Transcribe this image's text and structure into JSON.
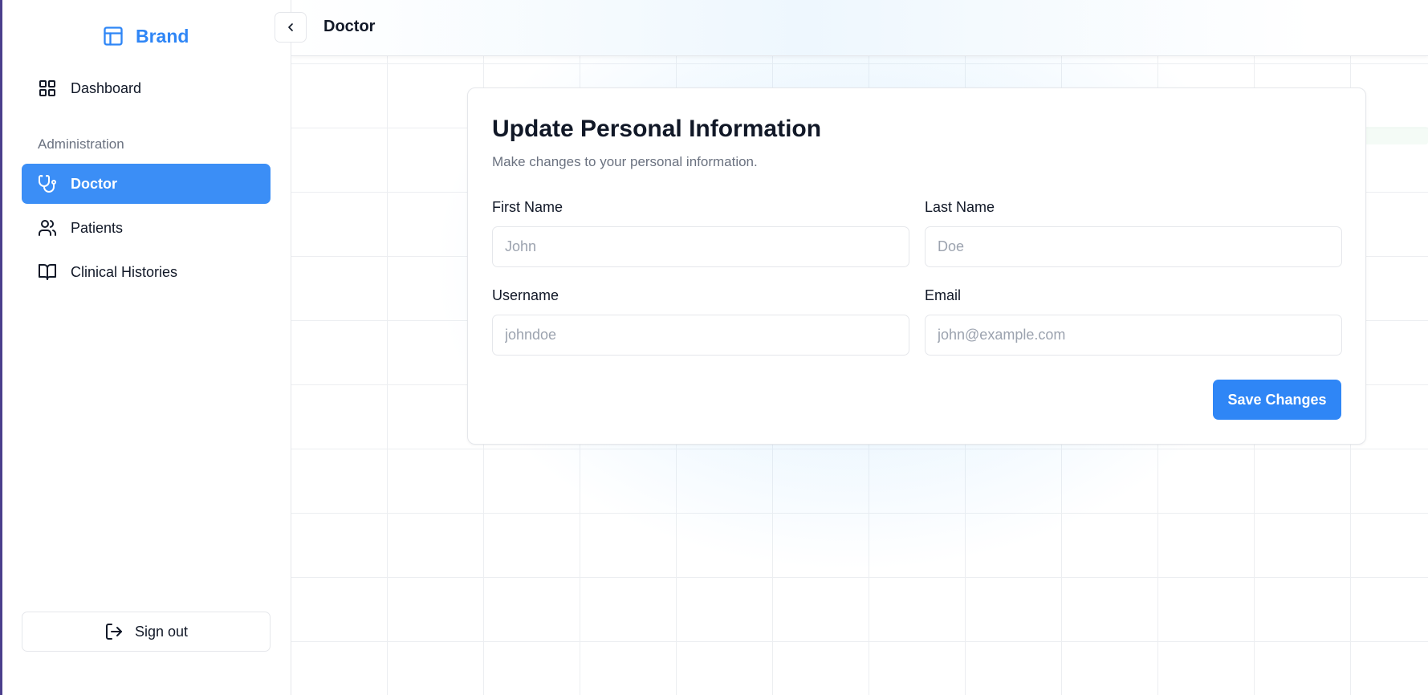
{
  "brand": {
    "name": "Brand",
    "icon": "layout-panel-icon",
    "color": "#2f86f6"
  },
  "sidebar": {
    "items": [
      {
        "label": "Dashboard",
        "icon": "grid-icon"
      },
      {
        "label": "Doctor",
        "icon": "stethoscope-icon",
        "active": true
      },
      {
        "label": "Patients",
        "icon": "users-icon"
      },
      {
        "label": "Clinical Histories",
        "icon": "book-open-icon"
      }
    ],
    "section_label": "Administration",
    "signout_label": "Sign out",
    "signout_icon": "log-out-icon"
  },
  "header": {
    "title": "Doctor",
    "collapse_icon": "chevron-left-icon"
  },
  "form": {
    "title": "Update Personal Information",
    "subtitle": "Make changes to your personal information.",
    "fields": {
      "first_name": {
        "label": "First Name",
        "placeholder": "John",
        "value": ""
      },
      "last_name": {
        "label": "Last Name",
        "placeholder": "Doe",
        "value": ""
      },
      "username": {
        "label": "Username",
        "placeholder": "johndoe",
        "value": ""
      },
      "email": {
        "label": "Email",
        "placeholder": "john@example.com",
        "value": ""
      }
    },
    "save_label": "Save Changes"
  },
  "colors": {
    "accent": "#2f86f6",
    "active_nav": "#3b8ef6"
  }
}
